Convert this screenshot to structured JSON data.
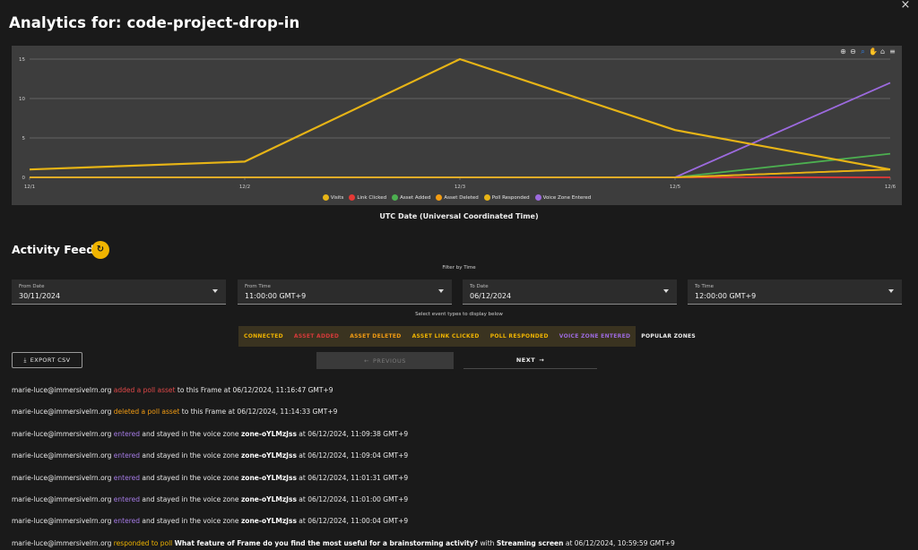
{
  "window": {
    "close_symbol": "×"
  },
  "page_title": "Analytics for: code-project-drop-in",
  "chart_toolbar": [
    "zoom-in-icon",
    "zoom-out-icon",
    "selection-zoom-icon",
    "pan-hand-icon",
    "home-reset-icon",
    "menu-icon"
  ],
  "chart_data": {
    "type": "line",
    "categories": [
      "12/1",
      "12/2",
      "12/3",
      "12/5",
      "12/6"
    ],
    "ylim": [
      0,
      15
    ],
    "yticks": [
      0,
      5,
      10,
      15
    ],
    "xlabel": "UTC Date (Universal Coordinated Time)",
    "ylabel": "",
    "grid": true,
    "legend_placement": "bottom-center",
    "series": [
      {
        "name": "Visits",
        "color": "#e7b416",
        "values": [
          1,
          2,
          15,
          6,
          1
        ]
      },
      {
        "name": "Link Clicked",
        "color": "#e53935",
        "values": [
          0,
          0,
          0,
          0,
          0
        ]
      },
      {
        "name": "Asset Added",
        "color": "#4caf50",
        "values": [
          0,
          0,
          0,
          0,
          3
        ]
      },
      {
        "name": "Asset Deleted",
        "color": "#f39c12",
        "values": [
          0,
          0,
          0,
          0,
          1
        ]
      },
      {
        "name": "Poll Responded",
        "color": "#e7b416",
        "values": [
          0,
          0,
          0,
          0,
          1
        ]
      },
      {
        "name": "Voice Zone Entered",
        "color": "#9c6ade",
        "values": [
          0,
          0,
          0,
          0,
          12
        ]
      }
    ]
  },
  "activity_feed": {
    "title": "Activity Feed",
    "refresh_symbol": "↻"
  },
  "filters": {
    "caption": "Filter by Time",
    "from_date": {
      "label": "From Date",
      "value": "30/11/2024"
    },
    "from_time": {
      "label": "From Time",
      "value": "11:00:00 GMT+9"
    },
    "to_date": {
      "label": "To Date",
      "value": "06/12/2024"
    },
    "to_time": {
      "label": "To Time",
      "value": "12:00:00 GMT+9"
    }
  },
  "event_types": {
    "caption": "Select event types to display below",
    "buttons": [
      {
        "label": "CONNECTED",
        "color": "#f0b400",
        "bg": "#3a3320"
      },
      {
        "label": "ASSET ADDED",
        "color": "#d63a3a",
        "bg": "#3a3320"
      },
      {
        "label": "ASSET DELETED",
        "color": "#f39c12",
        "bg": "#3a3320"
      },
      {
        "label": "ASSET LINK CLICKED",
        "color": "#f0b400",
        "bg": "#3a3320"
      },
      {
        "label": "POLL RESPONDED",
        "color": "#f0b400",
        "bg": "#3a3320"
      },
      {
        "label": "VOICE ZONE ENTERED",
        "color": "#9c6ade",
        "bg": "#3a3320"
      },
      {
        "label": "POPULAR ZONES",
        "color": "#f0f0f0",
        "bg": "#1a1a1a"
      }
    ]
  },
  "actions": {
    "export_label": "EXPORT CSV",
    "export_icon": "⤓",
    "prev_label": "PREVIOUS",
    "prev_icon": "←",
    "next_label": "NEXT",
    "next_icon": "→"
  },
  "feed": [
    {
      "user": "marie-luce@immersivelrn.org",
      "action": "added a poll asset",
      "action_color": "#e04848",
      "mid": " to this Frame at 06/12/2024, 11:16:47 GMT+9",
      "bold": "",
      "tail": "",
      "bold2": "",
      "tail2": ""
    },
    {
      "user": "marie-luce@immersivelrn.org",
      "action": "deleted a poll asset",
      "action_color": "#f39c12",
      "mid": " to this Frame at 06/12/2024, 11:14:33 GMT+9",
      "bold": "",
      "tail": "",
      "bold2": "",
      "tail2": ""
    },
    {
      "user": "marie-luce@immersivelrn.org",
      "action": "entered",
      "action_color": "#a57be6",
      "mid": " and stayed in the voice zone ",
      "bold": "zone-oYLMzJss",
      "tail": " at 06/12/2024, 11:09:38 GMT+9",
      "bold2": "",
      "tail2": ""
    },
    {
      "user": "marie-luce@immersivelrn.org",
      "action": "entered",
      "action_color": "#a57be6",
      "mid": " and stayed in the voice zone ",
      "bold": "zone-oYLMzJss",
      "tail": " at 06/12/2024, 11:09:04 GMT+9",
      "bold2": "",
      "tail2": ""
    },
    {
      "user": "marie-luce@immersivelrn.org",
      "action": "entered",
      "action_color": "#a57be6",
      "mid": " and stayed in the voice zone ",
      "bold": "zone-oYLMzJss",
      "tail": " at 06/12/2024, 11:01:31 GMT+9",
      "bold2": "",
      "tail2": ""
    },
    {
      "user": "marie-luce@immersivelrn.org",
      "action": "entered",
      "action_color": "#a57be6",
      "mid": " and stayed in the voice zone ",
      "bold": "zone-oYLMzJss",
      "tail": " at 06/12/2024, 11:01:00 GMT+9",
      "bold2": "",
      "tail2": ""
    },
    {
      "user": "marie-luce@immersivelrn.org",
      "action": "entered",
      "action_color": "#a57be6",
      "mid": " and stayed in the voice zone ",
      "bold": "zone-oYLMzJss",
      "tail": " at 06/12/2024, 11:00:04 GMT+9",
      "bold2": "",
      "tail2": ""
    },
    {
      "user": "marie-luce@immersivelrn.org",
      "action": "responded to poll",
      "action_color": "#f0b400",
      "mid": " ",
      "bold": "What feature of Frame do you find the most useful for a brainstorming activity?",
      "tail": " with ",
      "bold2": "Streaming screen",
      "tail2": " at 06/12/2024, 10:59:59 GMT+9"
    }
  ]
}
